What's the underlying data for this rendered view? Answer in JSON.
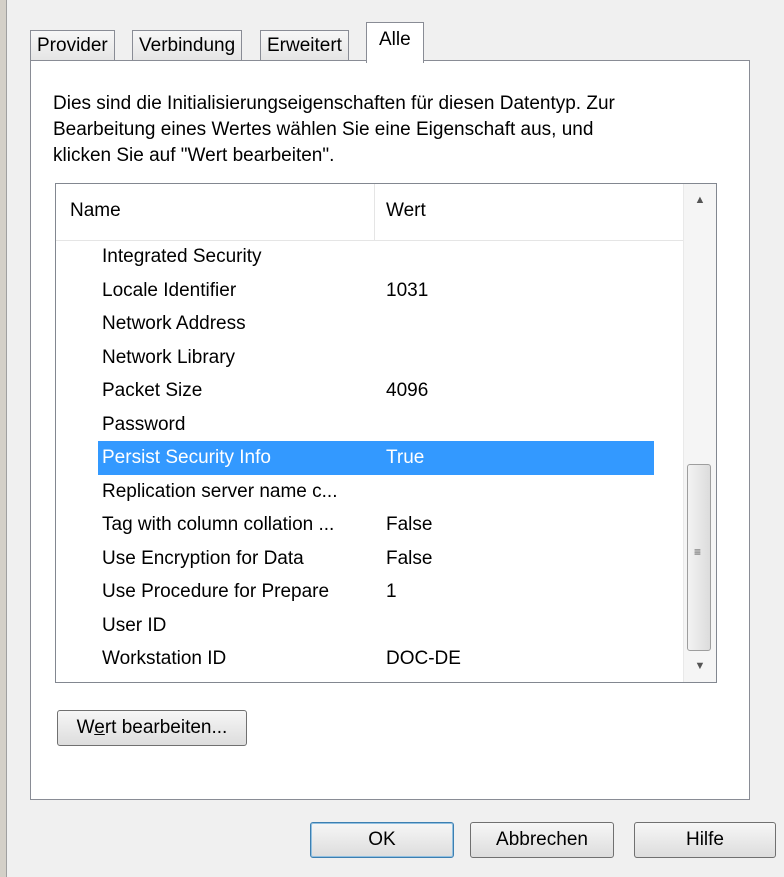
{
  "tabs": [
    {
      "label": "Provider"
    },
    {
      "label": "Verbindung"
    },
    {
      "label": "Erweitert"
    },
    {
      "label": "Alle"
    }
  ],
  "description": "Dies sind die Initialisierungseigenschaften für diesen Datentyp. Zur\nBearbeitung eines Wertes wählen Sie eine Eigenschaft aus, und\nklicken Sie auf \"Wert bearbeiten\".",
  "list": {
    "columns": {
      "name": "Name",
      "value": "Wert"
    },
    "rows": [
      {
        "name": "Integrated Security",
        "value": ""
      },
      {
        "name": "Locale Identifier",
        "value": "1031"
      },
      {
        "name": "Network Address",
        "value": ""
      },
      {
        "name": "Network Library",
        "value": ""
      },
      {
        "name": "Packet Size",
        "value": "4096"
      },
      {
        "name": "Password",
        "value": ""
      },
      {
        "name": "Persist Security Info",
        "value": "True",
        "selected": true
      },
      {
        "name": "Replication server name c...",
        "value": ""
      },
      {
        "name": "Tag with column collation ...",
        "value": "False"
      },
      {
        "name": "Use Encryption for Data",
        "value": "False"
      },
      {
        "name": "Use Procedure for Prepare",
        "value": "1"
      },
      {
        "name": "User ID",
        "value": ""
      },
      {
        "name": "Workstation ID",
        "value": "DOC-DE"
      }
    ]
  },
  "buttons": {
    "edit_prefix": "W",
    "edit_accel": "e",
    "edit_suffix": "rt bearbeiten...",
    "ok": "OK",
    "cancel": "Abbrechen",
    "help": "Hilfe"
  },
  "colors": {
    "selection": "#3399ff",
    "panel": "#ffffff",
    "dialog": "#f0f0f0"
  },
  "icons": {
    "scroll_up": "▲",
    "scroll_down": "▼",
    "scroll_grip": "≡"
  }
}
